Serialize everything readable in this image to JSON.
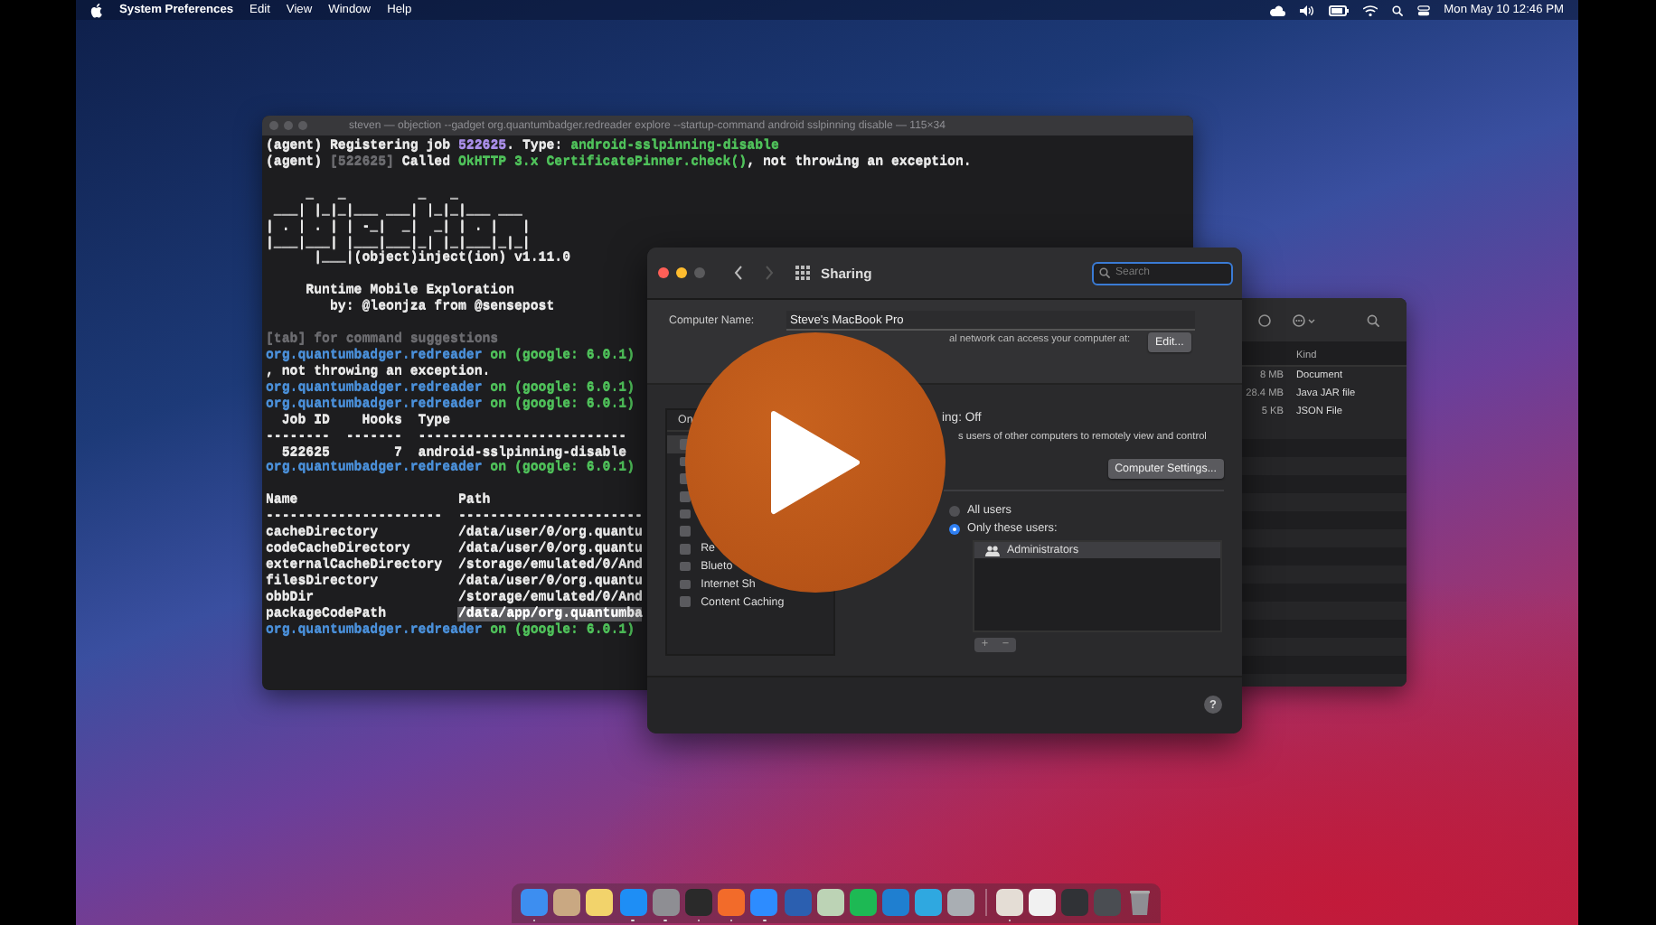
{
  "menu_bar": {
    "app_name": "System Preferences",
    "menus": [
      "Edit",
      "View",
      "Window",
      "Help"
    ],
    "clock": "Mon May 10  12:46 PM"
  },
  "terminal": {
    "title": "steven — objection --gadget org.quantumbadger.redreader explore --startup-command android sslpinning disable — 115×34",
    "lines": [
      {
        "kind": "text",
        "segments": [
          {
            "text": "(agent) Registering job ",
            "color": "#e8e8e8"
          },
          {
            "text": "522625",
            "color": "#a98ee8"
          },
          {
            "text": ". Type: ",
            "color": "#e8e8e8"
          },
          {
            "text": "android-sslpinning-disable",
            "color": "#4fc05a"
          }
        ]
      },
      {
        "kind": "text",
        "segments": [
          {
            "text": "(agent) ",
            "color": "#e8e8e8"
          },
          {
            "text": "[522625]",
            "color": "#6c6c70"
          },
          {
            "text": " Called ",
            "color": "#e8e8e8"
          },
          {
            "text": "OkHTTP 3.x CertificatePinner.check()",
            "color": "#4fc05a"
          },
          {
            "text": ", not throwing an exception.",
            "color": "#e8e8e8"
          }
        ]
      },
      {
        "kind": "blank"
      },
      {
        "kind": "logo",
        "segments": [
          {
            "text": "     _   _         _   _"
          }
        ]
      },
      {
        "kind": "logo",
        "segments": [
          {
            "text": " ___| |_|_|___ ___| |_|_|___ ___",
            "color": "#e8e8e8"
          }
        ]
      },
      {
        "kind": "logo",
        "segments": [
          {
            "text": "| . | . | | -_|  _|  _| | . |   |",
            "color": "#e8e8e8"
          }
        ]
      },
      {
        "kind": "logo",
        "segments": [
          {
            "text": "|___|___| |___|___|_| |_|___|_|_|",
            "color": "#e8e8e8"
          }
        ]
      },
      {
        "kind": "logo",
        "segments": [
          {
            "text": "      |___|(object)inject(ion) v1.11.0",
            "color": "#e8e8e8"
          }
        ]
      },
      {
        "kind": "blank"
      },
      {
        "kind": "logo",
        "segments": [
          {
            "text": "     Runtime Mobile Exploration",
            "color": "#e8e8e8"
          }
        ]
      },
      {
        "kind": "logo",
        "segments": [
          {
            "text": "        by: @leonjza from @sensepost",
            "color": "#e8e8e8"
          }
        ]
      },
      {
        "kind": "blank"
      },
      {
        "kind": "text",
        "segments": [
          {
            "text": "[tab] for command suggestions",
            "color": "#6c6c70"
          }
        ]
      },
      {
        "kind": "text",
        "segments": [
          {
            "text": "org.quantumbadger.redreader",
            "color": "#4a8fd8"
          },
          {
            "text": " on (google: 6.0.1)",
            "color": "#4fc05a"
          }
        ]
      },
      {
        "kind": "text",
        "segments": [
          {
            "text": ", not throwing an exception.",
            "color": "#e8e8e8"
          }
        ]
      },
      {
        "kind": "text",
        "segments": [
          {
            "text": "org.quantumbadger.redreader",
            "color": "#4a8fd8"
          },
          {
            "text": " on (google: 6.0.1)",
            "color": "#4fc05a"
          }
        ]
      },
      {
        "kind": "text",
        "segments": [
          {
            "text": "org.quantumbadger.redreader",
            "color": "#4a8fd8"
          },
          {
            "text": " on (google: 6.0.1)",
            "color": "#4fc05a"
          }
        ]
      },
      {
        "kind": "text",
        "segments": [
          {
            "text": "  Job ID    Hooks  Type",
            "color": "#e8e8e8"
          }
        ]
      },
      {
        "kind": "text",
        "segments": [
          {
            "text": "--------  -------  --------------------------",
            "color": "#e8e8e8"
          }
        ]
      },
      {
        "kind": "text",
        "segments": [
          {
            "text": "  522625        7  android-sslpinning-disable",
            "color": "#e8e8e8"
          }
        ]
      },
      {
        "kind": "text",
        "segments": [
          {
            "text": "org.quantumbadger.redreader",
            "color": "#4a8fd8"
          },
          {
            "text": " on (google: 6.0.1)",
            "color": "#4fc05a"
          }
        ]
      },
      {
        "kind": "blank"
      },
      {
        "kind": "text",
        "segments": [
          {
            "text": "Name                    Path",
            "color": "#e8e8e8"
          }
        ]
      },
      {
        "kind": "text",
        "segments": [
          {
            "text": "----------------------  -----------------------",
            "color": "#e8e8e8"
          }
        ]
      },
      {
        "kind": "text",
        "segments": [
          {
            "text": "cacheDirectory          /data/user/0/org.quantu",
            "color": "#e8e8e8"
          }
        ]
      },
      {
        "kind": "text",
        "segments": [
          {
            "text": "codeCacheDirectory      /data/user/0/org.quantu",
            "color": "#e8e8e8"
          }
        ]
      },
      {
        "kind": "text",
        "segments": [
          {
            "text": "externalCacheDirectory  /storage/emulated/0/And",
            "color": "#e8e8e8"
          }
        ]
      },
      {
        "kind": "text",
        "segments": [
          {
            "text": "filesDirectory          /data/user/0/org.quantu",
            "color": "#e8e8e8"
          }
        ]
      },
      {
        "kind": "text",
        "segments": [
          {
            "text": "obbDir                  /storage/emulated/0/And",
            "color": "#e8e8e8"
          }
        ]
      },
      {
        "kind": "text",
        "segments": [
          {
            "text": "packageCodePath         ",
            "color": "#e8e8e8",
            "selected": false
          },
          {
            "text": "/data/app/org.quantumba",
            "selected": true
          }
        ]
      },
      {
        "kind": "text",
        "segments": [
          {
            "text": "org.quantumbadger.redreader",
            "color": "#4a8fd8"
          },
          {
            "text": " on (google: 6.0.1)",
            "color": "#4fc05a"
          }
        ]
      }
    ]
  },
  "finder": {
    "column": "Kind",
    "rows": [
      {
        "size": "8 MB",
        "type": "Document"
      },
      {
        "size": "28.4 MB",
        "type": "Java JAR file"
      },
      {
        "size": "5 KB",
        "type": "JSON File"
      }
    ]
  },
  "sharing": {
    "title": "Sharing",
    "search": {
      "placeholder": "Search"
    },
    "computer_name": {
      "label": "Computer Name:",
      "value": "Steve's MacBook Pro"
    },
    "network_note": "al network can access your computer at:",
    "edit_button": "Edit...",
    "services": {
      "header": "On",
      "items": [
        {
          "checked": false,
          "selected": true
        },
        {
          "checked": false,
          "selected": false
        },
        {
          "checked": false,
          "selected": false
        },
        {
          "checked": false,
          "selected": false
        },
        {
          "checked": false,
          "selected": false
        },
        {
          "checked": false,
          "selected": false
        },
        {
          "label": "Re",
          "checked": false,
          "selected": false
        },
        {
          "label": "Blueto",
          "checked": false,
          "selected": false
        },
        {
          "label": "Internet Sh",
          "checked": false,
          "selected": false
        },
        {
          "label": "Content Caching",
          "checked": false,
          "selected": false
        }
      ]
    },
    "status": "ing: Off",
    "description": "s users of other computers to remotely view and control",
    "settings_button": "Computer Settings...",
    "access": [
      {
        "label": "All users",
        "selected": false
      },
      {
        "label": "Only these users:",
        "selected": true
      }
    ],
    "users": [
      {
        "name": "Administrators",
        "selected": true
      }
    ],
    "add_button": "+",
    "remove_button": "−",
    "help_button": "?"
  },
  "dock": [
    {
      "color": "#3d8ef0",
      "running": true
    },
    {
      "color": "#c9a882",
      "running": false
    },
    {
      "color": "#f2d36b",
      "running": false
    },
    {
      "color": "#1e8ef5",
      "running": true
    },
    {
      "color": "#8e8e93",
      "running": true
    },
    {
      "color": "#2a2a2a",
      "running": true
    },
    {
      "color": "#f26b2a",
      "running": true
    },
    {
      "color": "#2d8cff",
      "running": true
    },
    {
      "color": "#2b5fb0",
      "running": false
    },
    {
      "color": "#bcd3b5",
      "running": false
    },
    {
      "color": "#1db954",
      "running": false
    },
    {
      "color": "#1f7fd0",
      "running": false
    },
    {
      "color": "#2fa8e0",
      "running": false
    },
    {
      "color": "#a9aeb3",
      "running": false
    },
    {
      "color": "#e4ddd5",
      "running": true
    },
    {
      "color": "#f1f1f1",
      "running": false
    },
    {
      "color": "#303236",
      "running": false
    },
    {
      "color": "#4a4d52",
      "running": false
    }
  ]
}
